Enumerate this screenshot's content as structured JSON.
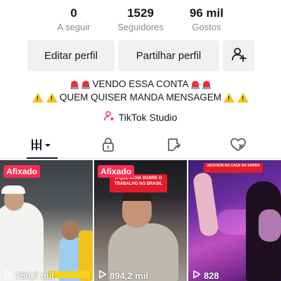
{
  "stats": {
    "following": {
      "value": "0",
      "label": "A seguir"
    },
    "followers": {
      "value": "1529",
      "label": "Seguidores"
    },
    "likes": {
      "value": "96 mil",
      "label": "Gostos"
    }
  },
  "actions": {
    "edit_label": "Editar perfil",
    "share_label": "Partilhar perfil",
    "add_friend_icon": "add-person-icon"
  },
  "bio": {
    "line1": "VENDO ESSA CONTA",
    "line2": "QUEM QUISER MANDA MENSAGEM"
  },
  "studio": {
    "label": "TikTok Studio",
    "icon": "person-star-icon"
  },
  "tabs": [
    {
      "name": "videos",
      "icon": "grid-icon"
    },
    {
      "name": "private",
      "icon": "lock-icon"
    },
    {
      "name": "reposts",
      "icon": "repost-icon"
    },
    {
      "name": "liked",
      "icon": "heart-icon"
    }
  ],
  "videos": [
    {
      "pinned_label": "Afixado",
      "views": "750,7 mil"
    },
    {
      "pinned_label": "Afixado",
      "views": "894,2 mil",
      "caption": "O QUE ACHA SOBRE O TRABALHO NO BRASIL"
    },
    {
      "views": "828",
      "caption": "JACKSON NA CASA DA SARRA"
    }
  ],
  "colors": {
    "accent": "#fe2c55",
    "button_bg": "#f1f1f2",
    "secondary_text": "#8a8b91"
  }
}
